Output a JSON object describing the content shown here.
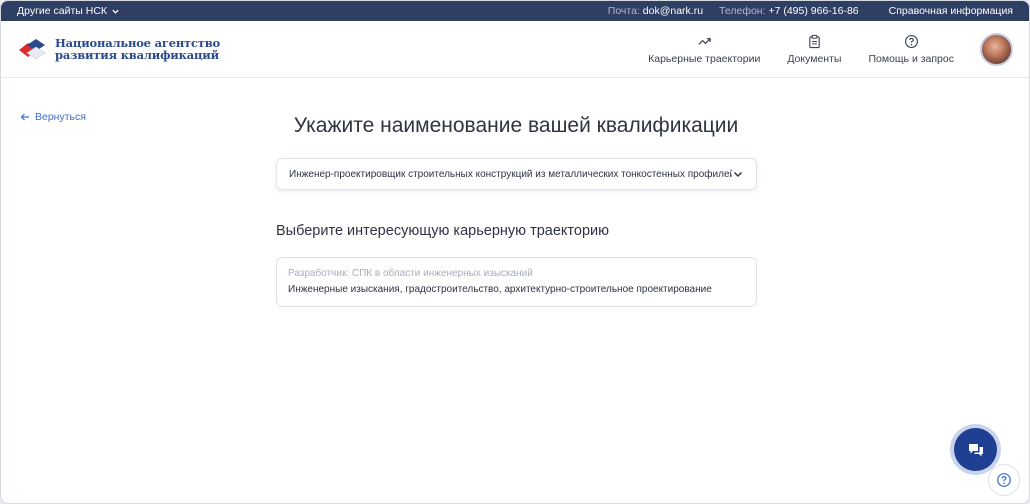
{
  "topbar": {
    "other_sites": "Другие сайты НСК",
    "email_label": "Почта:",
    "email": "dok@nark.ru",
    "phone_label": "Телефон:",
    "phone": "+7 (495) 966-16-86",
    "reference": "Справочная информация"
  },
  "header": {
    "logo_line1": "Национальное агентство",
    "logo_line2": "развития квалификаций",
    "nav": [
      {
        "label": "Карьерные траектории",
        "icon": "trending-up-icon"
      },
      {
        "label": "Документы",
        "icon": "clipboard-icon"
      },
      {
        "label": "Помощь и запрос",
        "icon": "question-icon"
      }
    ]
  },
  "page": {
    "back": "Вернуться",
    "title": "Укажите наименование вашей квалификации",
    "qualification_value": "Инженер-проектировщик строительных конструкций из металлических тонкостенных профилей (...",
    "subtitle": "Выберите интересующую карьерную траекторию",
    "trajectory": {
      "developer": "Разработчик: СПК в области инженерных изысканий",
      "area": "Инженерные изыскания, градостроительство, архитектурно-строительное проектирование"
    }
  },
  "colors": {
    "topbar": "#2f3f63",
    "accent": "#3d6fcf",
    "chat_button": "#1f3f93"
  }
}
